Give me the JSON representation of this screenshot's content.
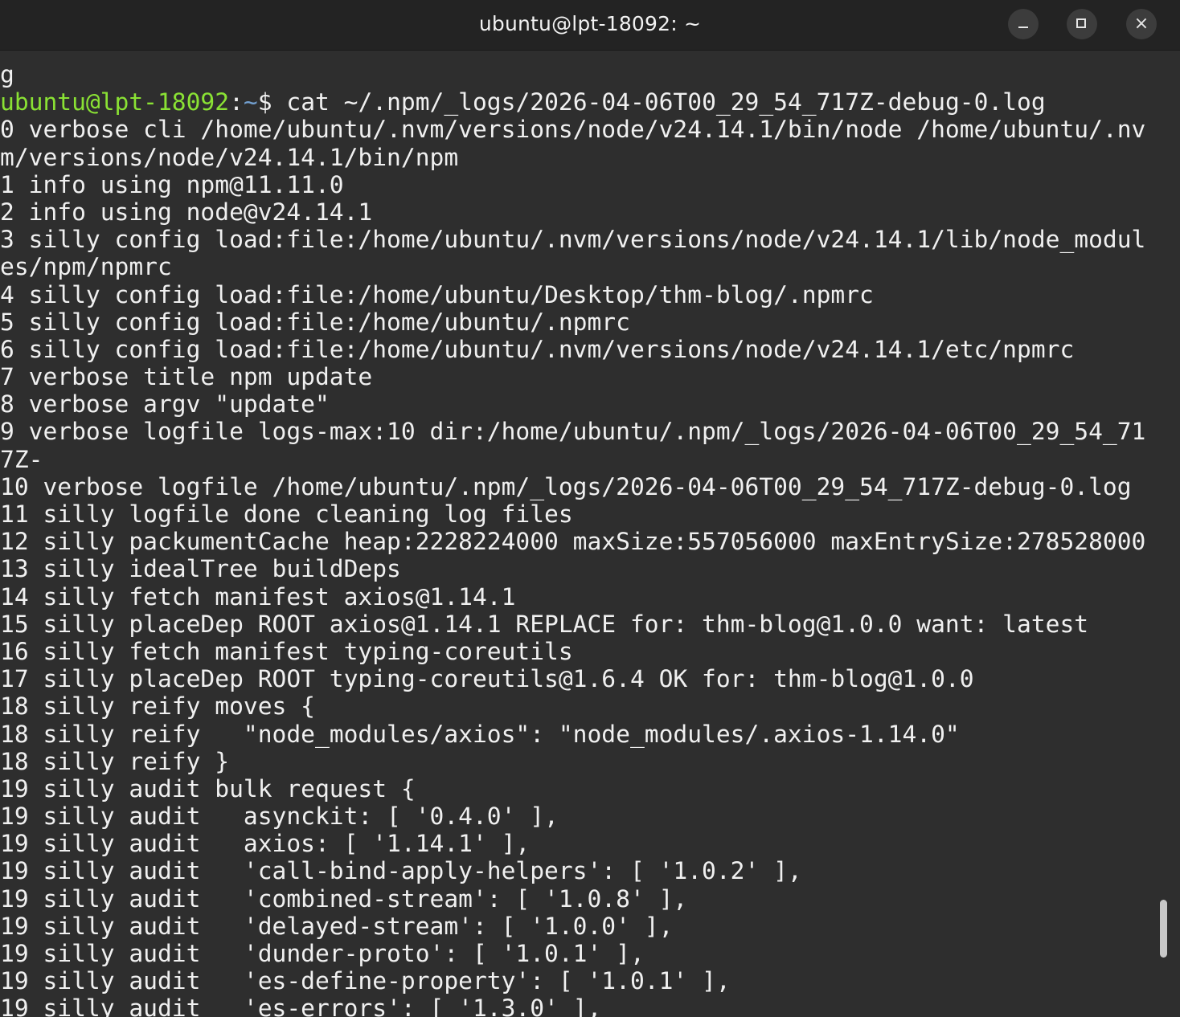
{
  "window": {
    "title": "ubuntu@lpt-18092: ~",
    "buttons": {
      "minimize": "minimize",
      "maximize": "maximize",
      "close": "×"
    }
  },
  "terminal": {
    "first_line": "g",
    "prompt": {
      "user_host": "ubuntu@lpt-18092",
      "separator": ":",
      "path": "~",
      "symbol": "$ ",
      "command": "cat ~/.npm/_logs/2026-04-06T00_29_54_717Z-debug-0.log"
    },
    "lines": [
      "0 verbose cli /home/ubuntu/.nvm/versions/node/v24.14.1/bin/node /home/ubuntu/.nv",
      "m/versions/node/v24.14.1/bin/npm",
      "1 info using npm@11.11.0",
      "2 info using node@v24.14.1",
      "3 silly config load:file:/home/ubuntu/.nvm/versions/node/v24.14.1/lib/node_modul",
      "es/npm/npmrc",
      "4 silly config load:file:/home/ubuntu/Desktop/thm-blog/.npmrc",
      "5 silly config load:file:/home/ubuntu/.npmrc",
      "6 silly config load:file:/home/ubuntu/.nvm/versions/node/v24.14.1/etc/npmrc",
      "7 verbose title npm update",
      "8 verbose argv \"update\"",
      "9 verbose logfile logs-max:10 dir:/home/ubuntu/.npm/_logs/2026-04-06T00_29_54_71",
      "7Z-",
      "10 verbose logfile /home/ubuntu/.npm/_logs/2026-04-06T00_29_54_717Z-debug-0.log",
      "11 silly logfile done cleaning log files",
      "12 silly packumentCache heap:2228224000 maxSize:557056000 maxEntrySize:278528000",
      "13 silly idealTree buildDeps",
      "14 silly fetch manifest axios@1.14.1",
      "15 silly placeDep ROOT axios@1.14.1 REPLACE for: thm-blog@1.0.0 want: latest",
      "16 silly fetch manifest typing-coreutils",
      "17 silly placeDep ROOT typing-coreutils@1.6.4 OK for: thm-blog@1.0.0",
      "18 silly reify moves {",
      "18 silly reify   \"node_modules/axios\": \"node_modules/.axios-1.14.0\"",
      "18 silly reify }",
      "19 silly audit bulk request {",
      "19 silly audit   asynckit: [ '0.4.0' ],",
      "19 silly audit   axios: [ '1.14.1' ],",
      "19 silly audit   'call-bind-apply-helpers': [ '1.0.2' ],",
      "19 silly audit   'combined-stream': [ '1.0.8' ],",
      "19 silly audit   'delayed-stream': [ '1.0.0' ],",
      "19 silly audit   'dunder-proto': [ '1.0.1' ],",
      "19 silly audit   'es-define-property': [ '1.0.1' ],",
      "19 silly audit   'es-errors': [ '1.3.0' ],"
    ]
  },
  "colors": {
    "background": "#2e2e2e",
    "titlebar": "#232323",
    "text": "#f0f0f0",
    "prompt_user": "#8ae234",
    "prompt_path": "#729fcf"
  }
}
